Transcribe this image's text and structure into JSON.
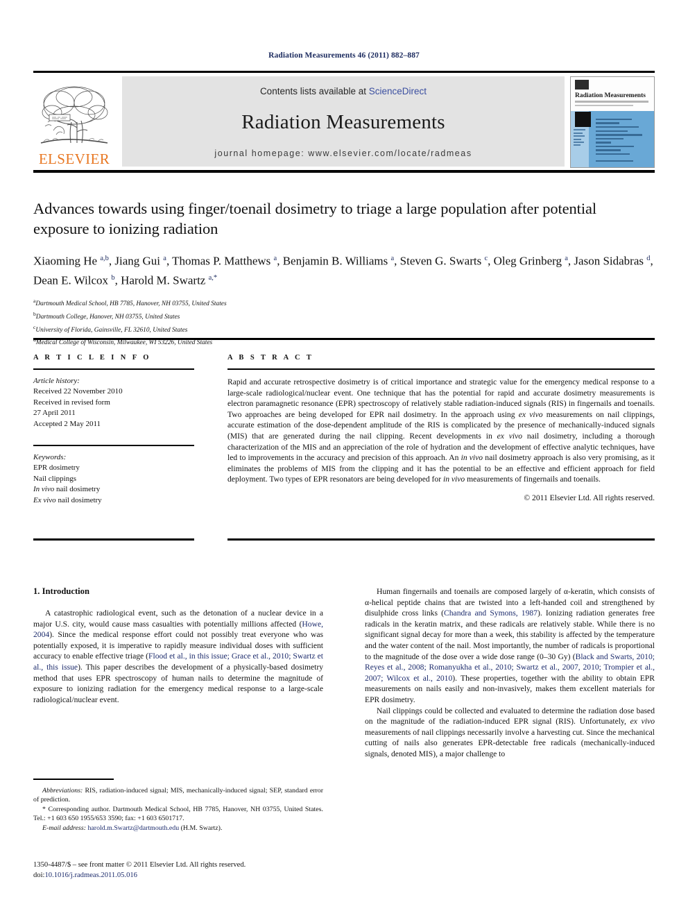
{
  "running_head": "Radiation Measurements 46 (2011) 882–887",
  "masthead": {
    "publisher_wordmark": "ELSEVIER",
    "contents_prefix": "Contents lists available at ",
    "contents_link": "ScienceDirect",
    "journal_title": "Radiation Measurements",
    "homepage": "journal homepage: www.elsevier.com/locate/radmeas",
    "cover_title": "Radiation Measurements",
    "accent_orange": "#e87722",
    "link_blue": "#3b4fa0",
    "band_gray": "#e3e3e3",
    "cover_blue": "#69a8d6"
  },
  "article": {
    "title": "Advances towards using finger/toenail dosimetry to triage a large population after potential exposure to ionizing radiation",
    "authors_html": "Xiaoming He <sup>a,b</sup>, Jiang Gui <sup>a</sup>, Thomas P. Matthews <sup>a</sup>, Benjamin B. Williams <sup>a</sup>, Steven G. Swarts <sup>c</sup>, Oleg Grinberg <sup>a</sup>, Jason Sidabras <sup>d</sup>, Dean E. Wilcox <sup>b</sup>, Harold M. Swartz <sup>a,*</sup>",
    "affiliations": [
      {
        "mark": "a",
        "text": "Dartmouth Medical School, HB 7785, Hanover, NH 03755, United States"
      },
      {
        "mark": "b",
        "text": "Dartmouth College, Hanover, NH 03755, United States"
      },
      {
        "mark": "c",
        "text": "University of Florida, Gainsville, FL 32610, United States"
      },
      {
        "mark": "d",
        "text": "Medical College of Wisconsin, Milwaukee, WI 53226, United States"
      }
    ]
  },
  "article_info": {
    "heading": "A R T I C L E  I N F O",
    "history_label": "Article history:",
    "history": [
      "Received 22 November 2010",
      "Received in revised form",
      "27 April 2011",
      "Accepted 2 May 2011"
    ],
    "keywords_label": "Keywords:",
    "keywords": [
      "EPR dosimetry",
      "Nail clippings",
      "In vivo nail dosimetry",
      "Ex vivo nail dosimetry"
    ]
  },
  "abstract": {
    "heading": "A B S T R A C T",
    "text_html": "Rapid and accurate retrospective dosimetry is of critical importance and strategic value for the emergency medical response to a large-scale radiological/nuclear event. One technique that has the potential for rapid and accurate dosimetry measurements is electron paramagnetic resonance (EPR) spectroscopy of relatively stable radiation-induced signals (RIS) in fingernails and toenails. Two approaches are being developed for EPR nail dosimetry. In the approach using <i>ex vivo</i> measurements on nail clippings, accurate estimation of the dose-dependent amplitude of the RIS is complicated by the presence of mechanically-induced signals (MIS) that are generated during the nail clipping. Recent developments in <i>ex vivo</i> nail dosimetry, including a thorough characterization of the MIS and an appreciation of the role of hydration and the development of effective analytic techniques, have led to improvements in the accuracy and precision of this approach. An <i>in vivo</i> nail dosimetry approach is also very promising, as it eliminates the problems of MIS from the clipping and it has the potential to be an effective and efficient approach for field deployment. Two types of EPR resonators are being developed for <i>in vivo</i> measurements of fingernails and toenails.",
    "copyright": "© 2011 Elsevier Ltd. All rights reserved."
  },
  "body": {
    "section_heading": "1. Introduction",
    "left_paragraphs_html": [
      "A catastrophic radiological event, such as the detonation of a nuclear device in a major U.S. city, would cause mass casualties with potentially millions affected (<span class=\"ref\">Howe, 2004</span>). Since the medical response effort could not possibly treat everyone who was potentially exposed, it is imperative to rapidly measure individual doses with sufficient accuracy to enable effective triage (<span class=\"ref\">Flood et al., in this issue; Grace et al., 2010; Swartz et al., this issue</span>). This paper describes the development of a physically-based dosimetry method that uses EPR spectroscopy of human nails to determine the magnitude of exposure to ionizing radiation for the emergency medical response to a large-scale radiological/nuclear event."
    ],
    "right_paragraphs_html": [
      "Human fingernails and toenails are composed largely of α-keratin, which consists of α-helical peptide chains that are twisted into a left-handed coil and strengthened by disulphide cross links (<span class=\"ref\">Chandra and Symons, 1987</span>). Ionizing radiation generates free radicals in the keratin matrix, and these radicals are relatively stable. While there is no significant signal decay for more than a week, this stability is affected by the temperature and the water content of the nail. Most importantly, the number of radicals is proportional to the magnitude of the dose over a wide dose range (0–30 Gy) (<span class=\"ref\">Black and Swarts, 2010; Reyes et al., 2008; Romanyukha et al., 2010; Swartz et al., 2007, 2010; Trompier et al., 2007; Wilcox et al., 2010</span>). These properties, together with the ability to obtain EPR measurements on nails easily and non-invasively, makes them excellent materials for EPR dosimetry.",
      "Nail clippings could be collected and evaluated to determine the radiation dose based on the magnitude of the radiation-induced EPR signal (RIS). Unfortunately, <i>ex vivo</i> measurements of nail clippings necessarily involve a harvesting cut. Since the mechanical cutting of nails also generates EPR-detectable free radicals (mechanically-induced signals, denoted MIS), a major challenge to"
    ]
  },
  "footnotes": {
    "abbreviations_html": "<span class=\"it\">Abbreviations:</span> RIS, radiation-induced signal; MIS, mechanically-induced signal; SEP, standard error of prediction.",
    "corresponding_html": "* Corresponding author. Dartmouth Medical School, HB 7785, Hanover, NH 03755, United States. Tel.: +1 603 650 1955/653 3590; fax: +1 603 6501717.",
    "email_label": "E-mail address:",
    "email": "harold.m.Swartz@dartmouth.edu",
    "email_owner": "(H.M. Swartz)."
  },
  "imprint": {
    "line1": "1350-4487/$ – see front matter © 2011 Elsevier Ltd. All rights reserved.",
    "doi_prefix": "doi:",
    "doi": "10.1016/j.radmeas.2011.05.016"
  }
}
